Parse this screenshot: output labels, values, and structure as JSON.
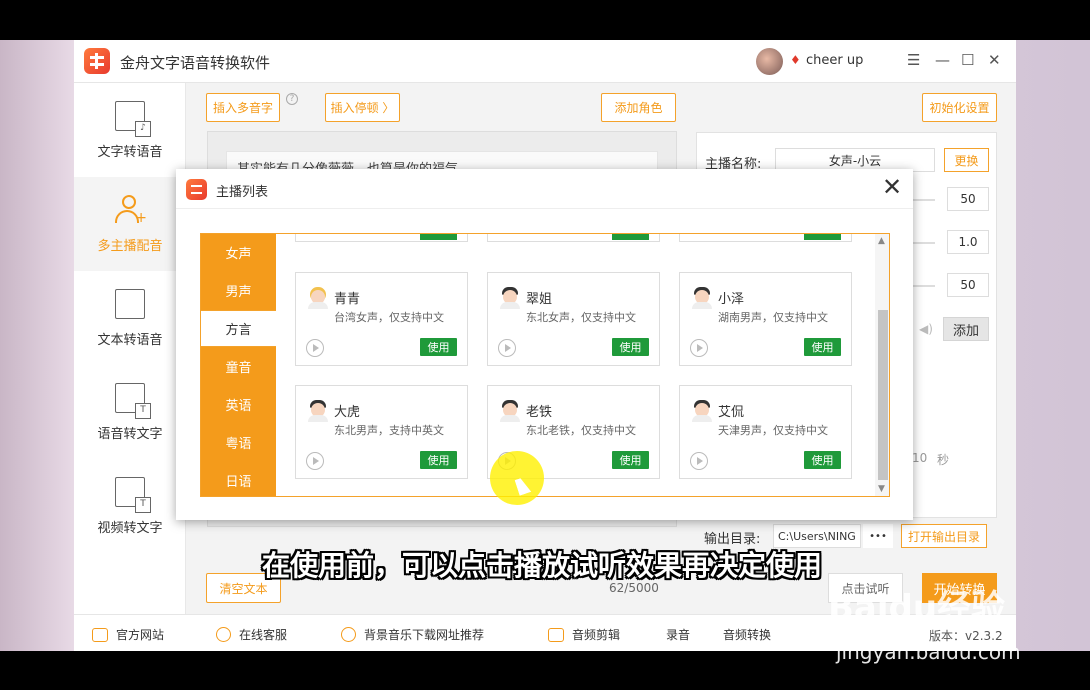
{
  "app": {
    "title": "金舟文字语音转换软件",
    "username": "cheer up",
    "version": "版本：v2.3.2"
  },
  "window": {
    "min": "—",
    "max": "☐",
    "close": "✕",
    "menu": "☰"
  },
  "sidebar": {
    "items": [
      {
        "label": "文字转语音",
        "icon": "text-to-speech-icon"
      },
      {
        "label": "多主播配音",
        "icon": "multi-anchor-icon"
      },
      {
        "label": "文本转语音",
        "icon": "document-to-speech-icon"
      },
      {
        "label": "语音转文字",
        "icon": "speech-to-text-icon"
      },
      {
        "label": "视频转文字",
        "icon": "video-to-text-icon"
      }
    ]
  },
  "toolbar": {
    "insert_polyphone": "插入多音字",
    "insert_pause": "插入停顿 〉",
    "add_role": "添加角色",
    "init_settings": "初始化设置"
  },
  "editor": {
    "text": "其实能有几分像薇薇，也算是你的福气",
    "clear_button": "清空文本",
    "char_count": "62/5000"
  },
  "settings": {
    "anchor_label": "主播名称:",
    "anchor_value": "女声-小云",
    "change_button": "更换",
    "values": [
      "50",
      "1.0",
      "50"
    ],
    "add_button": "添加",
    "seconds_value": "10",
    "seconds_unit": "秒",
    "output_label": "输出目录:",
    "output_path": "C:\\Users\\NING",
    "output_more": "•••",
    "open_output_button": "打开输出目录",
    "listen_button": "点击试听",
    "start_button": "开始转换"
  },
  "footer": {
    "official_site": "官方网站",
    "online_service": "在线客服",
    "bgm_link": "背景音乐下载网址推荐",
    "audio_cut": "音频剪辑",
    "record": "录音",
    "audio_convert": "音频转换"
  },
  "modal": {
    "title": "主播列表",
    "close": "✕",
    "categories": [
      "女声",
      "男声",
      "方言",
      "童音",
      "英语",
      "粤语",
      "日语"
    ],
    "active_category": "方言",
    "use_label": "使用",
    "voices": [
      {
        "name": "青青",
        "desc": "台湾女声，仅支持中文",
        "gender": "female"
      },
      {
        "name": "翠姐",
        "desc": "东北女声，仅支持中文",
        "gender": "male"
      },
      {
        "name": "小泽",
        "desc": "湖南男声，仅支持中文",
        "gender": "male"
      },
      {
        "name": "大虎",
        "desc": "东北男声，支持中英文",
        "gender": "male"
      },
      {
        "name": "老铁",
        "desc": "东北老铁，仅支持中文",
        "gender": "male"
      },
      {
        "name": "艾侃",
        "desc": "天津男声，仅支持中文",
        "gender": "male"
      }
    ]
  },
  "overlay": {
    "subtitle": "在使用前，可以点击播放试听效果再决定使用",
    "watermark": "Baidu经验",
    "watermark_url": "jingyan.baidu.com"
  }
}
